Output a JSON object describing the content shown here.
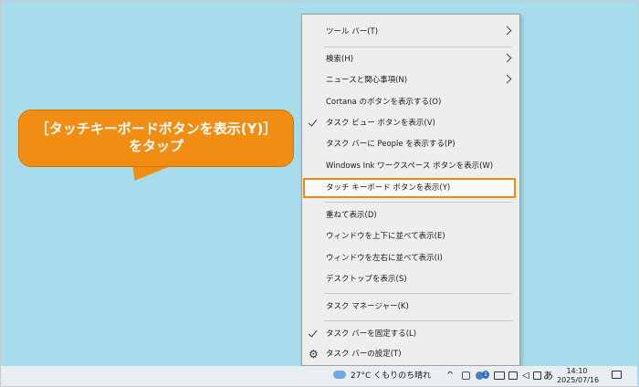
{
  "callout": {
    "line1": "［タッチキーボードボタンを表示(Y)］",
    "line2": "をタップ",
    "color": "#f28d14"
  },
  "menu": {
    "items": [
      {
        "label": "ツール バー(T)",
        "arrow": true
      },
      {
        "label": "検索(H)",
        "arrow": true
      },
      {
        "label": "ニュースと関心事項(N)",
        "arrow": true
      },
      {
        "label": "Cortana のボタンを表示する(O)"
      },
      {
        "label": "タスク ビュー ボタンを表示(V)",
        "checked": true
      },
      {
        "label": "タスク バーに People を表示する(P)"
      },
      {
        "label": "Windows Ink ワークスペース ボタンを表示(W)"
      },
      {
        "label": "タッチ キーボード ボタンを表示(Y)",
        "highlighted": true
      },
      {
        "label": "重ねて表示(D)"
      },
      {
        "label": "ウィンドウを上下に並べて表示(E)"
      },
      {
        "label": "ウィンドウを左右に並べて表示(I)"
      },
      {
        "label": "デスクトップを表示(S)"
      },
      {
        "label": "タスク マネージャー(K)"
      },
      {
        "label": "タスク バーを固定する(L)",
        "checked": true
      },
      {
        "label": "タスク バーの設定(T)",
        "icon": "gear-icon"
      }
    ],
    "highlight_color": "#ef8a11"
  },
  "taskbar": {
    "weather": "27°C くもりのち晴れ",
    "ime": "あ",
    "time": "14:10",
    "date": "2025/07/16",
    "badge": "1"
  }
}
